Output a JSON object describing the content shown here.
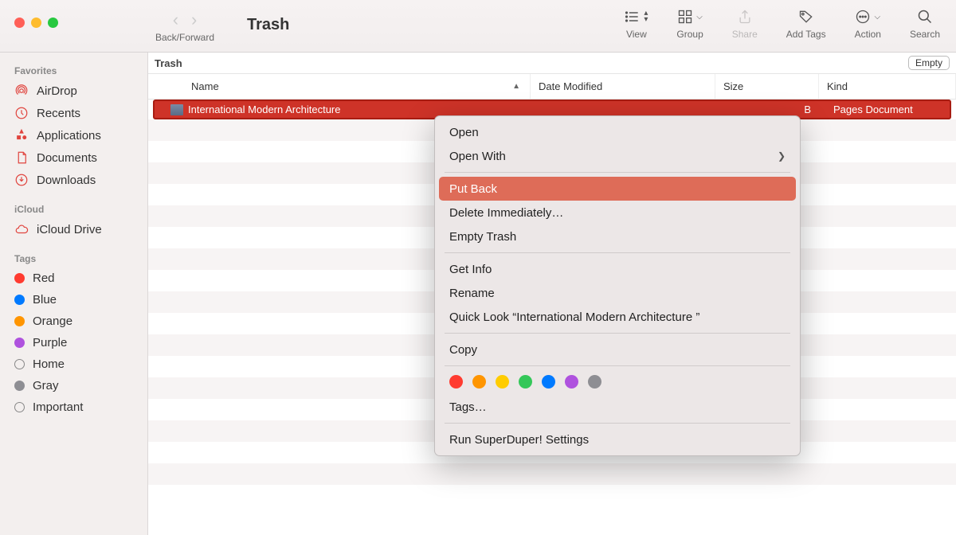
{
  "window": {
    "title": "Trash",
    "nav_label": "Back/Forward"
  },
  "toolbar": {
    "view": "View",
    "group": "Group",
    "share": "Share",
    "add_tags": "Add Tags",
    "action": "Action",
    "search": "Search"
  },
  "sidebar": {
    "favorites_header": "Favorites",
    "favorites": [
      {
        "label": "AirDrop",
        "icon": "airdrop"
      },
      {
        "label": "Recents",
        "icon": "clock"
      },
      {
        "label": "Applications",
        "icon": "apps"
      },
      {
        "label": "Documents",
        "icon": "doc"
      },
      {
        "label": "Downloads",
        "icon": "download"
      }
    ],
    "icloud_header": "iCloud",
    "icloud": [
      {
        "label": "iCloud Drive",
        "icon": "cloud"
      }
    ],
    "tags_header": "Tags",
    "tags": [
      {
        "label": "Red",
        "color": "#ff3b30"
      },
      {
        "label": "Blue",
        "color": "#007aff"
      },
      {
        "label": "Orange",
        "color": "#ff9500"
      },
      {
        "label": "Purple",
        "color": "#af52de"
      },
      {
        "label": "Home",
        "color": ""
      },
      {
        "label": "Gray",
        "color": "#8e8e93"
      },
      {
        "label": "Important",
        "color": ""
      }
    ]
  },
  "pathbar": {
    "location": "Trash",
    "empty_btn": "Empty"
  },
  "columns": {
    "name": "Name",
    "date_modified": "Date Modified",
    "size": "Size",
    "kind": "Kind"
  },
  "file_list": [
    {
      "name": "International Modern Architecture",
      "date_modified": "",
      "size": "B",
      "kind": "Pages Document",
      "selected": true
    }
  ],
  "context_menu": {
    "open": "Open",
    "open_with": "Open With",
    "put_back": "Put Back",
    "delete_immediately": "Delete Immediately…",
    "empty_trash": "Empty Trash",
    "get_info": "Get Info",
    "rename": "Rename",
    "quick_look": "Quick Look “International Modern Architecture ”",
    "copy": "Copy",
    "tags": "Tags…",
    "run_superduper": "Run SuperDuper! Settings",
    "highlighted": "put_back",
    "colors": [
      "#ff3b30",
      "#ff9500",
      "#ffcc00",
      "#34c759",
      "#007aff",
      "#af52de",
      "#8e8e93"
    ]
  }
}
